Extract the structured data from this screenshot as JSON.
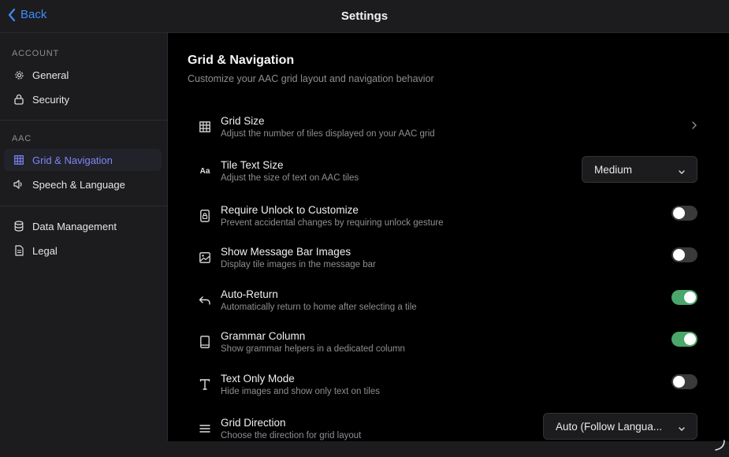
{
  "header": {
    "back_label": "Back",
    "title": "Settings"
  },
  "sidebar": {
    "sections": [
      {
        "label": "ACCOUNT",
        "items": [
          {
            "label": "General",
            "icon": "gear-icon"
          },
          {
            "label": "Security",
            "icon": "lock-icon"
          }
        ]
      },
      {
        "label": "AAC",
        "items": [
          {
            "label": "Grid & Navigation",
            "icon": "grid-icon",
            "active": true
          },
          {
            "label": "Speech & Language",
            "icon": "speaker-icon"
          }
        ]
      },
      {
        "label": "",
        "items": [
          {
            "label": "Data Management",
            "icon": "database-icon"
          },
          {
            "label": "Legal",
            "icon": "document-icon"
          }
        ]
      }
    ]
  },
  "main": {
    "title": "Grid & Navigation",
    "subtitle": "Customize your AAC grid layout and navigation behavior",
    "settings": [
      {
        "title": "Grid Size",
        "subtitle": "Adjust the number of tiles displayed on your AAC grid",
        "icon": "grid-icon",
        "control": "chevron"
      },
      {
        "title": "Tile Text Size",
        "subtitle": "Adjust the size of text on AAC tiles",
        "icon": "text-size-icon",
        "control": "select",
        "value": "Medium"
      },
      {
        "title": "Require Unlock to Customize",
        "subtitle": "Prevent accidental changes by requiring unlock gesture",
        "icon": "lock-device-icon",
        "control": "toggle",
        "on": false
      },
      {
        "title": "Show Message Bar Images",
        "subtitle": "Display tile images in the message bar",
        "icon": "image-icon",
        "control": "toggle",
        "on": false
      },
      {
        "title": "Auto-Return",
        "subtitle": "Automatically return to home after selecting a tile",
        "icon": "undo-icon",
        "control": "toggle",
        "on": true
      },
      {
        "title": "Grammar Column",
        "subtitle": "Show grammar helpers in a dedicated column",
        "icon": "book-icon",
        "control": "toggle",
        "on": true
      },
      {
        "title": "Text Only Mode",
        "subtitle": "Hide images and show only text on tiles",
        "icon": "text-icon",
        "control": "toggle",
        "on": false
      },
      {
        "title": "Grid Direction",
        "subtitle": "Choose the direction for grid layout",
        "icon": "menu-lines-icon",
        "control": "select",
        "value": "Auto (Follow Langua..."
      }
    ]
  },
  "colors": {
    "accent": "#7d86f5",
    "link": "#3d8bfd",
    "toggle_on": "#4aa66a"
  }
}
